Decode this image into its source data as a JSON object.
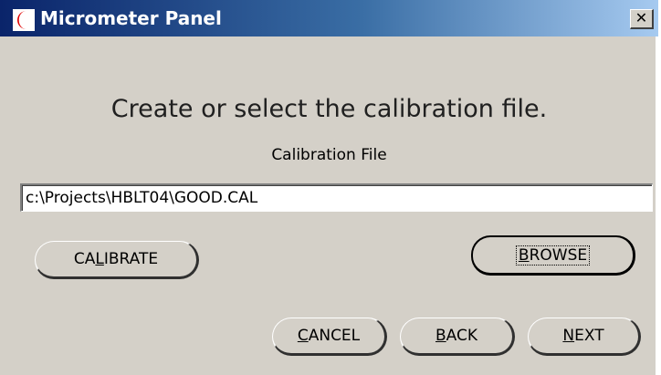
{
  "window": {
    "title": "Micrometer Panel",
    "close_glyph": "✕",
    "icon": "app-crescent-icon",
    "accent_colors": {
      "titlebar_start": "#0a246a",
      "titlebar_end": "#a6caf0",
      "icon_red": "#e00000"
    }
  },
  "content": {
    "instruction": "Create or select the calibration file.",
    "file_label": "Calibration File",
    "file_value": "c:\\Projects\\HBLT04\\GOOD.CAL"
  },
  "buttons": {
    "calibrate": {
      "pre": "CA",
      "mn": "L",
      "post": "IBRATE"
    },
    "browse": {
      "pre": "",
      "mn": "B",
      "post": "ROWSE"
    },
    "cancel": {
      "pre": "",
      "mn": "C",
      "post": "ANCEL"
    },
    "back": {
      "pre": "",
      "mn": "B",
      "post": "ACK"
    },
    "next": {
      "pre": "",
      "mn": "N",
      "post": "EXT"
    }
  }
}
